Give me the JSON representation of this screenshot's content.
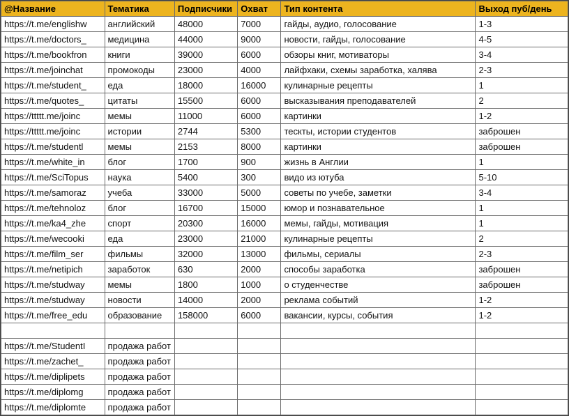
{
  "headers": [
    "@Название",
    "Тематика",
    "Подписчики",
    "Охват",
    "Тип контента",
    "Выход пуб/день"
  ],
  "rows": [
    {
      "name": "https://t.me/englishw",
      "topic": "английский",
      "subs": "48000",
      "reach": "7000",
      "content": "гайды, аудио, голосование",
      "perday": "1-3"
    },
    {
      "name": "https://t.me/doctors_",
      "topic": "медицина",
      "subs": "44000",
      "reach": "9000",
      "content": "новости, гайды, голосование",
      "perday": "4-5"
    },
    {
      "name": "https://t.me/bookfron",
      "topic": "книги",
      "subs": "39000",
      "reach": "6000",
      "content": "обзоры книг, мотиваторы",
      "perday": "3-4"
    },
    {
      "name": "https://t.me/joinchat",
      "topic": "промокоды",
      "subs": "23000",
      "reach": "4000",
      "content": "лайфхаки, схемы заработка, халява",
      "perday": "2-3"
    },
    {
      "name": "https://t.me/student_",
      "topic": "еда",
      "subs": "18000",
      "reach": "16000",
      "content": "кулинарные рецепты",
      "perday": "1"
    },
    {
      "name": "https://t.me/quotes_",
      "topic": "цитаты",
      "subs": "15500",
      "reach": "6000",
      "content": "высказывания преподавателей",
      "perday": "2"
    },
    {
      "name": "https://ttttt.me/joinc",
      "topic": "мемы",
      "subs": "11000",
      "reach": "6000",
      "content": "картинки",
      "perday": "1-2"
    },
    {
      "name": "https://ttttt.me/joinc",
      "topic": "истории",
      "subs": "2744",
      "reach": "5300",
      "content": "тескты, истории студентов",
      "perday": "заброшен"
    },
    {
      "name": "https://t.me/studentl",
      "topic": "мемы",
      "subs": "2153",
      "reach": "8000",
      "content": "картинки",
      "perday": "заброшен"
    },
    {
      "name": "https://t.me/white_in",
      "topic": "блог",
      "subs": "1700",
      "reach": "900",
      "content": "жизнь в Англии",
      "perday": "1"
    },
    {
      "name": "https://t.me/SciTopus",
      "topic": "наука",
      "subs": "5400",
      "reach": "300",
      "content": "видо из ютуба",
      "perday": "5-10"
    },
    {
      "name": "https://t.me/samoraz",
      "topic": "учеба",
      "subs": "33000",
      "reach": "5000",
      "content": "советы по учебе, заметки",
      "perday": "3-4"
    },
    {
      "name": "https://t.me/tehnoloz",
      "topic": "блог",
      "subs": "16700",
      "reach": "15000",
      "content": "юмор и познавательное",
      "perday": "1"
    },
    {
      "name": "https://t.me/ka4_zhe",
      "topic": "спорт",
      "subs": "20300",
      "reach": "16000",
      "content": "мемы, гайды, мотивация",
      "perday": "1"
    },
    {
      "name": "https://t.me/wecooki",
      "topic": "еда",
      "subs": "23000",
      "reach": "21000",
      "content": "кулинарные рецепты",
      "perday": "2"
    },
    {
      "name": "https://t.me/film_ser",
      "topic": "фильмы",
      "subs": "32000",
      "reach": "13000",
      "content": "фильмы, сериалы",
      "perday": "2-3"
    },
    {
      "name": "https://t.me/netipich",
      "topic": "заработок",
      "subs": "630",
      "reach": "2000",
      "content": "способы заработка",
      "perday": "заброшен"
    },
    {
      "name": "https://t.me/studway",
      "topic": "мемы",
      "subs": "1800",
      "reach": "1000",
      "content": "о студенчестве",
      "perday": "заброшен"
    },
    {
      "name": "https://t.me/studway",
      "topic": "новости",
      "subs": "14000",
      "reach": "2000",
      "content": "реклама событий",
      "perday": "1-2"
    },
    {
      "name": "https://t.me/free_edu",
      "topic": "образование",
      "subs": "158000",
      "reach": "6000",
      "content": "вакансии, курсы, события",
      "perday": "1-2"
    },
    {
      "name": "",
      "topic": "",
      "subs": "",
      "reach": "",
      "content": "",
      "perday": ""
    },
    {
      "name": "https://t.me/StudentI",
      "topic": "продажа работ",
      "subs": "",
      "reach": "",
      "content": "",
      "perday": ""
    },
    {
      "name": "https://t.me/zachet_",
      "topic": "продажа работ",
      "subs": "",
      "reach": "",
      "content": "",
      "perday": ""
    },
    {
      "name": "https://t.me/diplipets",
      "topic": "продажа работ",
      "subs": "",
      "reach": "",
      "content": "",
      "perday": ""
    },
    {
      "name": "https://t.me/diplomg",
      "topic": "продажа работ",
      "subs": "",
      "reach": "",
      "content": "",
      "perday": ""
    },
    {
      "name": "https://t.me/diplomte",
      "topic": "продажа работ",
      "subs": "",
      "reach": "",
      "content": "",
      "perday": ""
    }
  ]
}
